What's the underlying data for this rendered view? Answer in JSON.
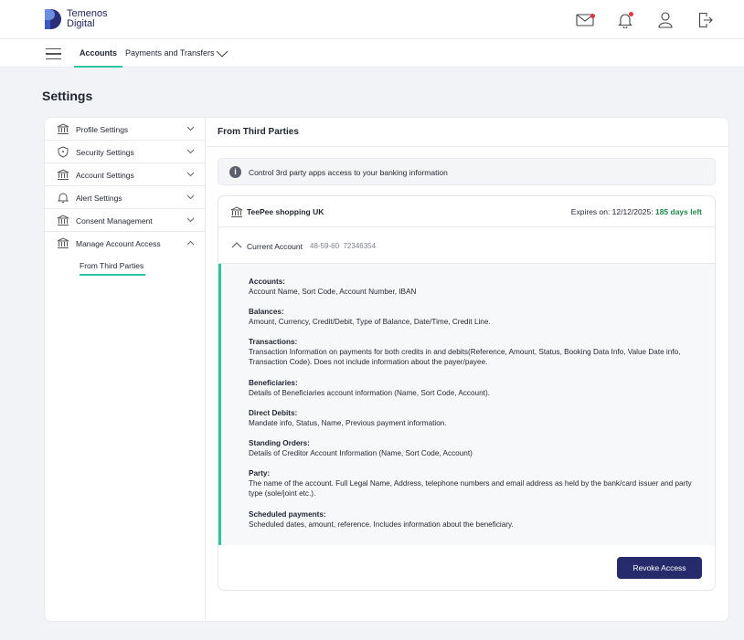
{
  "brand": {
    "line1": "Temenos",
    "line2": "Digital",
    "color": "#22255e"
  },
  "header_icons": [
    "mail-icon",
    "bell-icon",
    "user-icon",
    "logout-icon"
  ],
  "nav": {
    "tabs": [
      {
        "label": "Accounts",
        "active": true
      },
      {
        "label": "Payments and Transfers",
        "active": false
      }
    ]
  },
  "page": {
    "title": "Settings"
  },
  "sidebar": {
    "items": [
      {
        "label": "Profile Settings",
        "icon": "bank-icon"
      },
      {
        "label": "Security Settings",
        "icon": "shield-icon"
      },
      {
        "label": "Account Settings",
        "icon": "bank-icon"
      },
      {
        "label": "Alert Settings",
        "icon": "bell-icon"
      },
      {
        "label": "Consent Management",
        "icon": "bank-icon"
      },
      {
        "label": "Manage Account Access",
        "icon": "bank-icon",
        "expanded": true
      }
    ],
    "sub_item": "From Third Parties"
  },
  "content": {
    "title": "From Third Parties",
    "info": "Control 3rd party apps access to your banking information",
    "provider": {
      "name": "TeePee shopping UK",
      "expires_label": "Expires on: 12/12/2025:",
      "days_left": "185 days left"
    },
    "account": {
      "label": "Current Account",
      "sort_code": "48-59-60",
      "number": "72346354"
    },
    "permissions": [
      {
        "title": "Accounts:",
        "text": "Account Name, Sort Code, Account Number, IBAN"
      },
      {
        "title": "Balances:",
        "text": "Amount, Currency, Credit/Debit, Type of Balance, Date/Time, Credit Line."
      },
      {
        "title": "Transactions:",
        "text": "Transaction Information on payments for both credits in and debits(Reference, Amount, Status, Booking Data Info, Value Date info, Transaction Code). Does not include information about the payer/payee."
      },
      {
        "title": "Beneficiaries:",
        "text": "Details of Beneficiaries account information (Name, Sort Code, Account)."
      },
      {
        "title": "Direct Debits:",
        "text": "Mandate info, Status, Name, Previous payment information."
      },
      {
        "title": "Standing Orders:",
        "text": "Details of Creditor Account Information (Name, Sort Code, Account)"
      },
      {
        "title": "Party:",
        "text": "The name of the account. Full Legal Name, Address, telephone numbers and email address as held by the bank/card issuer and party type (sole/joint etc.)."
      },
      {
        "title": "Scheduled payments:",
        "text": "Scheduled dates, amount, reference. Includes information about the beneficiary."
      }
    ],
    "revoke_label": "Revoke Access"
  },
  "colors": {
    "accent": "#2ec4a0",
    "primary_button": "#262b6b",
    "days_left": "#1f8a4c",
    "notification_dot": "#e2353f"
  }
}
